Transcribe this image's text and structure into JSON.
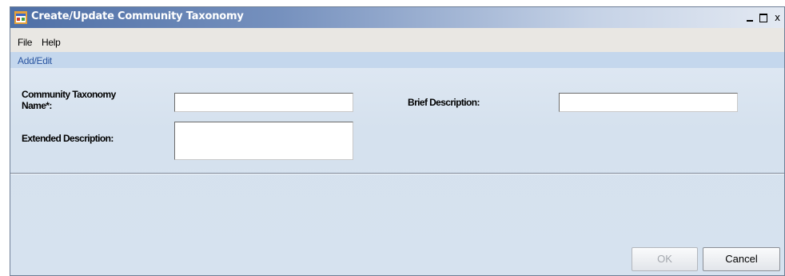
{
  "window": {
    "title": "Create/Update Community Taxonomy",
    "controls": {
      "minimize": "_",
      "maximize": "□",
      "close": "x"
    }
  },
  "menu": {
    "items": [
      {
        "label": "File"
      },
      {
        "label": "Help"
      }
    ]
  },
  "tab": {
    "label": "Add/Edit"
  },
  "form": {
    "name_label_line1": "Community Taxonomy",
    "name_label_line2": "Name*:",
    "name_value": "",
    "brief_label": "Brief Description:",
    "brief_value": "",
    "extended_label": "Extended Description:",
    "extended_value": ""
  },
  "buttons": {
    "ok_label": "OK",
    "ok_enabled": false,
    "cancel_label": "Cancel"
  },
  "colors": {
    "title_bar_start": "#4e6fa6",
    "tab_strip": "#c4d7ed",
    "tab_text": "#2a55a0",
    "form_background": "#d5e1ee"
  },
  "icons": {
    "app": "application-window-icon"
  }
}
